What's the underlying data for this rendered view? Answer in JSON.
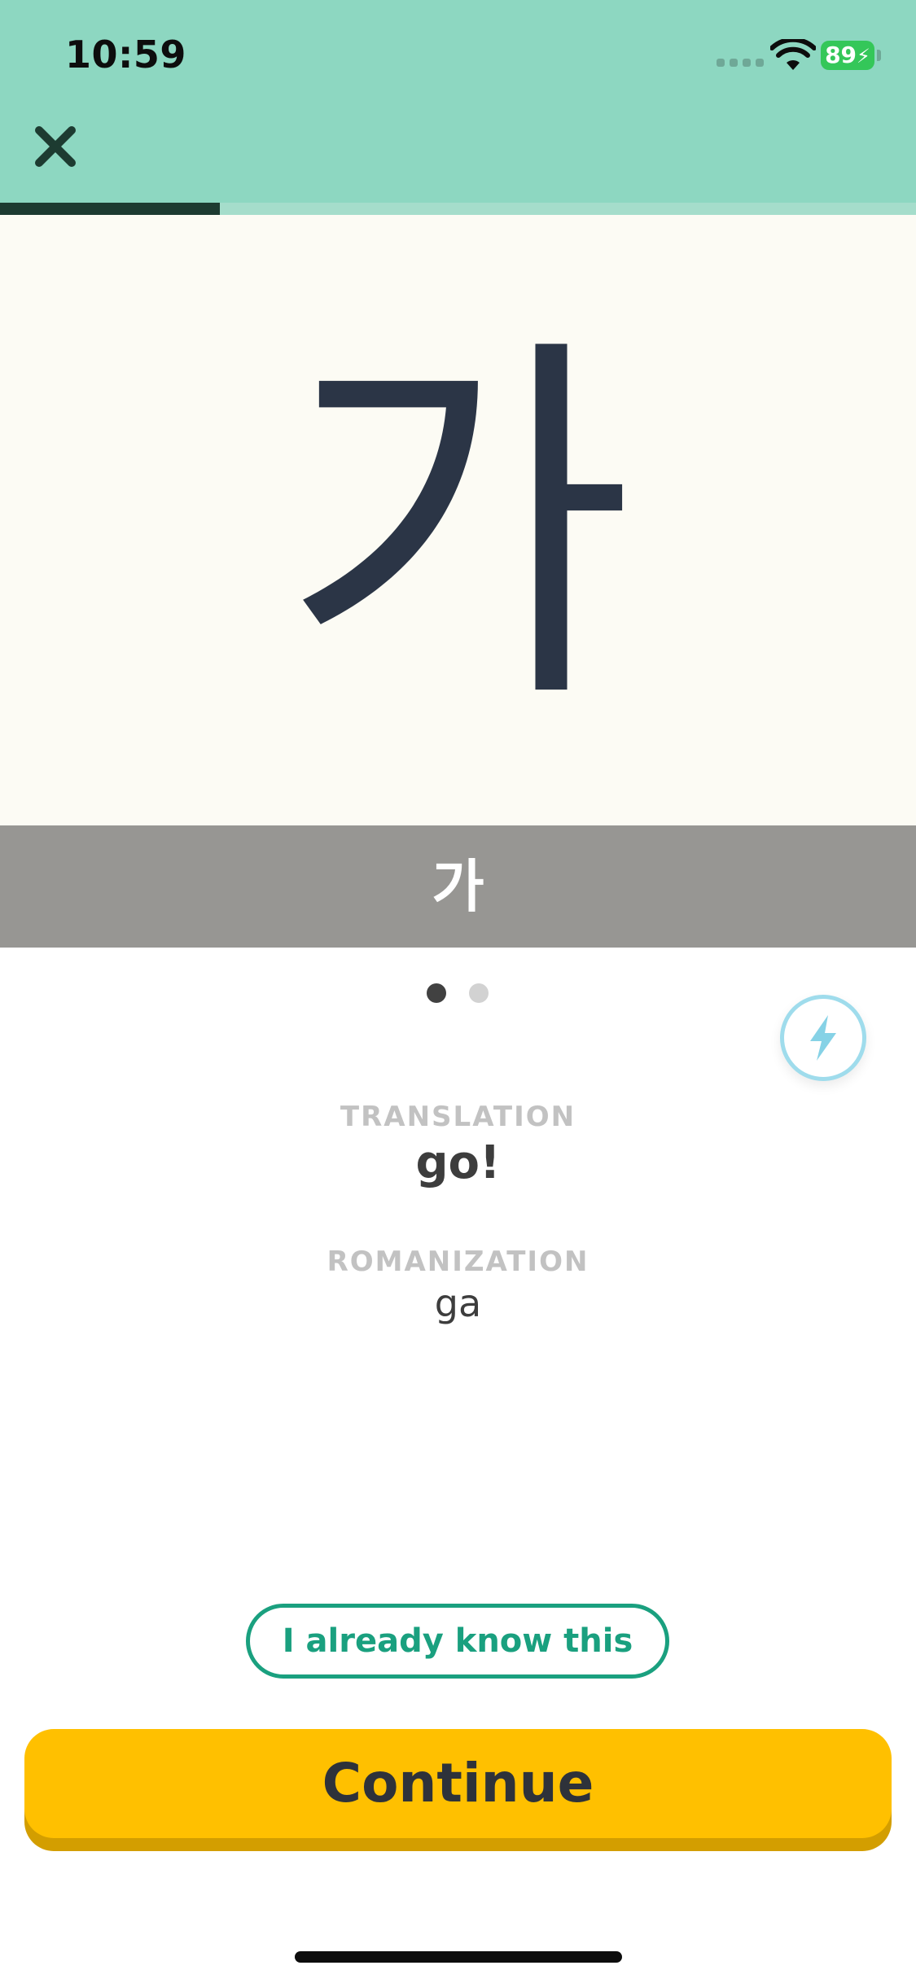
{
  "status_bar": {
    "time": "10:59",
    "battery_percent": "89",
    "battery_color": "#34c759"
  },
  "header": {
    "background_color": "#8dd7c1",
    "close_icon": "close-icon",
    "progress_fraction": 0.24
  },
  "card": {
    "character": "가",
    "label": "가",
    "pagination": {
      "total": 2,
      "active_index": 0
    }
  },
  "lightning_icon": "lightning-icon",
  "details": {
    "translation_label": "TRANSLATION",
    "translation_value": "go!",
    "romanization_label": "ROMANIZATION",
    "romanization_value": "ga"
  },
  "actions": {
    "know_label": "I already know this",
    "continue_label": "Continue",
    "continue_color": "#ffc000",
    "know_color": "#1aa07f"
  }
}
